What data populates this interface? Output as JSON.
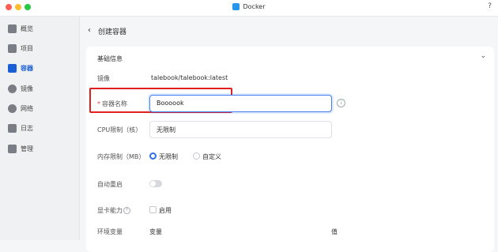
{
  "window": {
    "title": "Docker",
    "help": "?"
  },
  "colors": {
    "accent": "#1a5fd6",
    "highlight": "#e01f1f",
    "traffic_red": "#ff5f57",
    "traffic_yellow": "#febc2e",
    "traffic_green": "#28c840"
  },
  "sidebar": {
    "items": [
      {
        "label": "概览",
        "icon": "overview-icon"
      },
      {
        "label": "项目",
        "icon": "project-icon"
      },
      {
        "label": "容器",
        "icon": "container-icon",
        "active": true
      },
      {
        "label": "镜像",
        "icon": "image-icon"
      },
      {
        "label": "网络",
        "icon": "network-icon"
      },
      {
        "label": "日志",
        "icon": "log-icon"
      },
      {
        "label": "管理",
        "icon": "manage-icon"
      }
    ]
  },
  "header": {
    "back_icon": "‹",
    "title": "创建容器"
  },
  "form": {
    "section_title": "基础信息",
    "image_label": "镜像",
    "image_value": "talebook/talebook:latest",
    "name_label": "容器名称",
    "name_required": "*",
    "name_value": "Boooook",
    "cpu_label": "CPU限制（核）",
    "cpu_value": "无限制",
    "memory_label": "内存限制（MB）",
    "memory_options": [
      "无限制",
      "自定义"
    ],
    "memory_selected": "无限制",
    "restart_label": "自动重启",
    "restart_on": false,
    "gpu_label": "显卡能力",
    "gpu_option": "启用",
    "env_label": "环境变量",
    "env_columns": [
      "变量",
      "值"
    ]
  }
}
